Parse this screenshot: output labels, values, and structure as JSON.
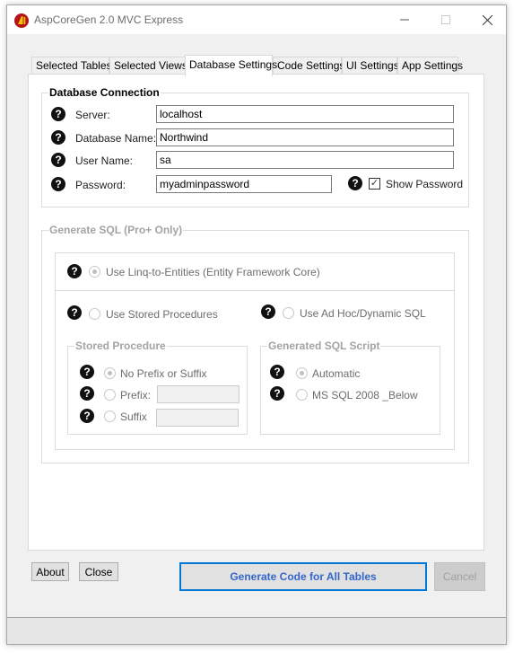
{
  "window": {
    "title": "AspCoreGen 2.0 MVC Express",
    "controls": {
      "minimize": "—",
      "maximize": "☐",
      "close": "✕"
    }
  },
  "tabs": [
    {
      "label": "Selected Tables",
      "active": false
    },
    {
      "label": "Selected Views",
      "active": false
    },
    {
      "label": "Database Settings",
      "active": true
    },
    {
      "label": "Code Settings",
      "active": false
    },
    {
      "label": "UI Settings",
      "active": false
    },
    {
      "label": "App Settings",
      "active": false
    }
  ],
  "database_connection": {
    "legend": "Database Connection",
    "server": {
      "label": "Server:",
      "value": "localhost"
    },
    "database_name": {
      "label": "Database Name:",
      "value": "Northwind"
    },
    "user_name": {
      "label": "User Name:",
      "value": "sa"
    },
    "password": {
      "label": "Password:",
      "value": "myadminpassword"
    },
    "show_password": {
      "label": "Show Password",
      "checked": true
    }
  },
  "generate_sql": {
    "legend": "Generate SQL (Pro+ Only)",
    "linq": {
      "label": "Use Linq-to-Entities (Entity Framework Core)",
      "selected": true
    },
    "stored_procedures": {
      "label": "Use Stored Procedures",
      "selected": false
    },
    "ad_hoc": {
      "label": "Use Ad Hoc/Dynamic SQL",
      "selected": false
    },
    "stored_procedure_group": {
      "legend": "Stored Procedure",
      "no_prefix": {
        "label": "No Prefix or Suffix",
        "selected": true
      },
      "prefix": {
        "label": "Prefix:",
        "selected": false,
        "value": ""
      },
      "suffix": {
        "label": "Suffix",
        "selected": false,
        "value": ""
      }
    },
    "generated_script_group": {
      "legend": "Generated SQL Script",
      "automatic": {
        "label": "Automatic",
        "selected": true
      },
      "ms_sql_2008": {
        "label": "MS SQL 2008 _Below",
        "selected": false
      }
    }
  },
  "buttons": {
    "about": "About",
    "close": "Close",
    "generate": "Generate Code for All Tables",
    "cancel": "Cancel"
  },
  "help_glyph": "?",
  "checkmark_glyph": "✓"
}
